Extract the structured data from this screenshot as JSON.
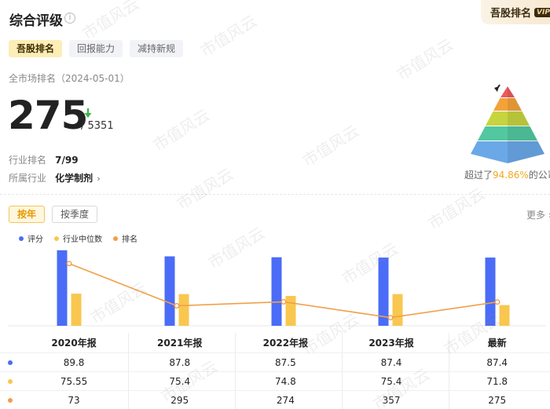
{
  "header": {
    "title": "综合评级",
    "info_icon": "i"
  },
  "promo": {
    "label": "吾股排名",
    "badge": "VIP"
  },
  "tabs": [
    {
      "label": "吾股排名",
      "active": true
    },
    {
      "label": "回报能力",
      "active": false
    },
    {
      "label": "减持新规",
      "active": false
    }
  ],
  "rank": {
    "date_label": "全市场排名（2024-05-01）",
    "value": "275",
    "total": "/ 5351",
    "trend": "down"
  },
  "industry_rank": {
    "label": "行业排名",
    "value": "7/99"
  },
  "industry": {
    "label": "所属行业",
    "value": "化学制剂",
    "chevron": "›"
  },
  "beat": {
    "prefix": "超过了",
    "percent": "94.86%",
    "suffix": "的公司"
  },
  "period_tabs": [
    {
      "label": "按年",
      "active": true
    },
    {
      "label": "按季度",
      "active": false
    }
  ],
  "more": {
    "label": "更多 ›"
  },
  "watermark": "市值风云",
  "colors": {
    "score": "#4a6cf7",
    "median": "#f9c74f",
    "rank": "#f0a04b"
  },
  "chart_data": {
    "type": "bar",
    "categories": [
      "2020年报",
      "2021年报",
      "2022年报",
      "2023年报",
      "最新"
    ],
    "series": [
      {
        "name": "评分",
        "kind": "bar",
        "color": "#4a6cf7",
        "values": [
          89.8,
          87.8,
          87.5,
          87.4,
          87.4
        ]
      },
      {
        "name": "行业中位数",
        "kind": "bar",
        "color": "#f9c74f",
        "values": [
          75.55,
          75.4,
          74.8,
          75.4,
          71.8
        ]
      },
      {
        "name": "排名",
        "kind": "line",
        "color": "#f0a04b",
        "values": [
          73,
          295,
          274,
          357,
          275
        ]
      }
    ],
    "ylim_bars": [
      65,
      90
    ],
    "ylim_rank": [
      0,
      400
    ],
    "rank_axis_inverted": true,
    "grid": false,
    "legend": "top-left"
  },
  "table": {
    "headers": [
      "2020年报",
      "2021年报",
      "2022年报",
      "2023年报",
      "最新"
    ],
    "rows": [
      {
        "series": "评分",
        "color": "#4a6cf7",
        "cells": [
          "89.8",
          "87.8",
          "87.5",
          "87.4",
          "87.4"
        ]
      },
      {
        "series": "行业中位数",
        "color": "#f9c74f",
        "cells": [
          "75.55",
          "75.4",
          "74.8",
          "75.4",
          "71.8"
        ]
      },
      {
        "series": "排名",
        "color": "#f0a04b",
        "cells": [
          "73",
          "295",
          "274",
          "357",
          "275"
        ]
      }
    ]
  }
}
